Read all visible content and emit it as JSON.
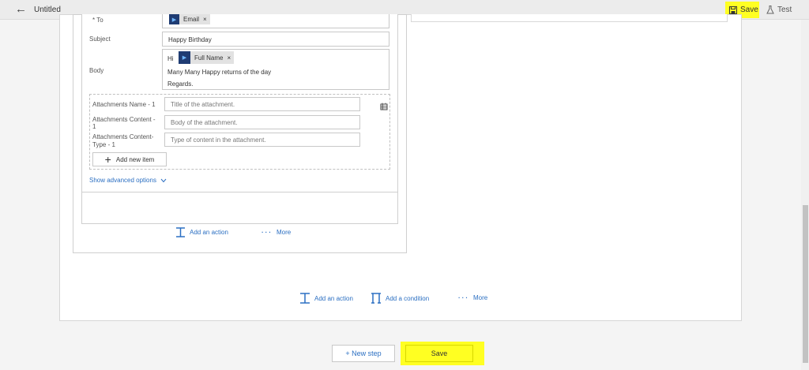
{
  "header": {
    "back_icon": "←",
    "title": "Untitled",
    "save_label": "Save",
    "test_label": "Test"
  },
  "form": {
    "to_label": "* To",
    "to_token": "Email",
    "subject_label": "Subject",
    "subject_value": "Happy Birthday",
    "body_label": "Body",
    "body_greeting": "Hi",
    "body_token": "Full Name",
    "body_line2": "Many Many Happy returns of the day",
    "body_line3": "Regards.",
    "attachments": {
      "name_label": "Attachments Name - 1",
      "name_placeholder": "Title of the attachment.",
      "content_label_1": "Attachments Content -",
      "content_label_2": "1",
      "content_placeholder": "Body of the attachment.",
      "type_label_1": "Attachments Content-",
      "type_label_2": "Type - 1",
      "type_placeholder": "Type of content in the attachment.",
      "add_new_label": "Add new item"
    },
    "advanced_label": "Show advanced options",
    "token_remove": "×"
  },
  "branch_actions": {
    "add_action_label": "Add an action",
    "more_label": "More"
  },
  "outer_actions": {
    "add_action_label": "Add an action",
    "add_condition_label": "Add a condition",
    "more_label": "More"
  },
  "footer": {
    "new_step_label": "+ New step",
    "save_label": "Save"
  },
  "colors": {
    "highlight": "#ffff22",
    "link": "#2b6fc2",
    "token_icon": "#1f3c73"
  }
}
